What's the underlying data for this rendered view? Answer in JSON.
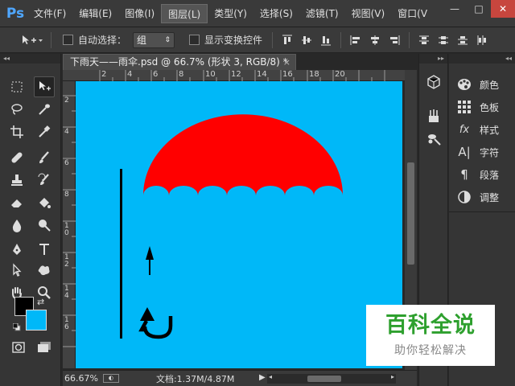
{
  "app": {
    "logo": "Ps"
  },
  "menu": [
    {
      "label": "文件(F)"
    },
    {
      "label": "编辑(E)"
    },
    {
      "label": "图像(I)"
    },
    {
      "label": "图层(L)"
    },
    {
      "label": "类型(Y)"
    },
    {
      "label": "选择(S)"
    },
    {
      "label": "滤镜(T)"
    },
    {
      "label": "视图(V)"
    },
    {
      "label": "窗口(V"
    }
  ],
  "window_controls": {
    "minimize": "—",
    "maximize": "□",
    "close": "✕"
  },
  "options": {
    "auto_select_label": "自动选择：",
    "auto_select_value": "组",
    "show_transform_label": "显示变换控件"
  },
  "document": {
    "tab_title": "下雨天——雨伞.psd @ 66.7% (形状 3, RGB/8) *",
    "tab_close": "×",
    "ruler_top": [
      "2",
      "4",
      "6",
      "8",
      "10",
      "12",
      "14",
      "16",
      "18",
      "20"
    ],
    "ruler_left": [
      "2",
      "4",
      "6",
      "8",
      "1 0",
      "1 2",
      "1 4",
      "1 6"
    ],
    "zoom": "66.67%",
    "info": "文档:1.37M/4.87M",
    "canvas_color": "#00b8f8",
    "umbrella_color": "#ff0000"
  },
  "panels": [
    {
      "label": "颜色",
      "icon": "palette-icon"
    },
    {
      "label": "色板",
      "icon": "swatches-icon"
    },
    {
      "label": "样式",
      "icon": "styles-icon"
    },
    {
      "label": "字符",
      "icon": "character-icon"
    },
    {
      "label": "段落",
      "icon": "paragraph-icon"
    },
    {
      "label": "调整",
      "icon": "adjustments-icon"
    }
  ],
  "colors": {
    "foreground": "#000000",
    "background": "#00b8f8"
  },
  "watermark": {
    "main": "百科全说",
    "sub": "助你轻松解决"
  }
}
